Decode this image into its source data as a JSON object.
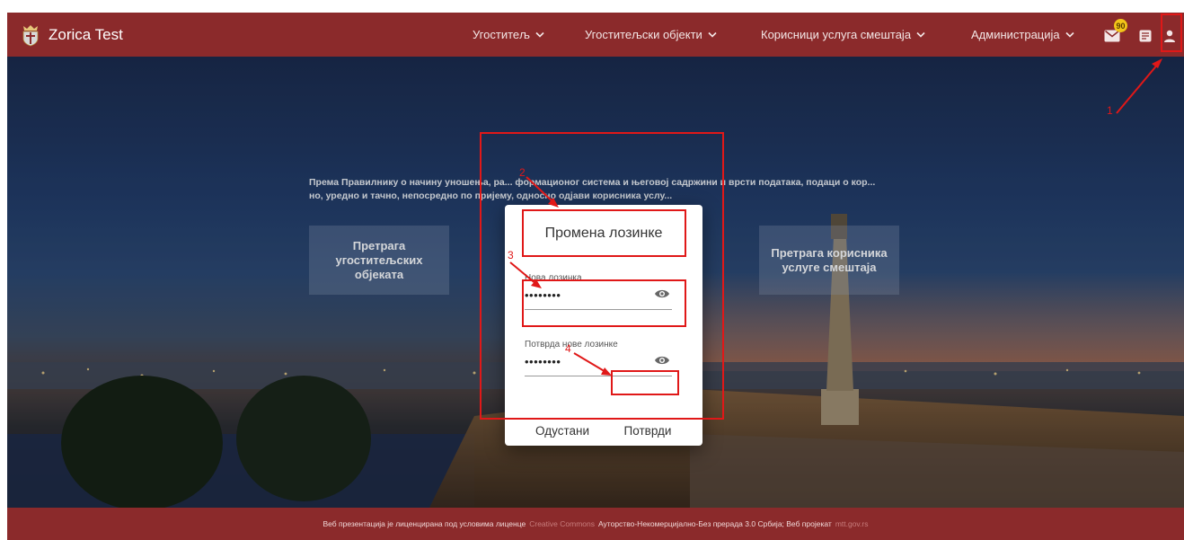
{
  "header": {
    "brand_name": "Zorica Test",
    "nav": [
      {
        "label": "Угоститељ"
      },
      {
        "label": "Угоститељски објекти"
      },
      {
        "label": "Корисници услуга смештаја"
      },
      {
        "label": "Администрација"
      }
    ],
    "notification_count": "90",
    "icons": [
      "crest-icon",
      "mail-icon",
      "messages-icon",
      "user-icon"
    ],
    "color": "#8b2a2b"
  },
  "hero": {
    "intro_text": "Према Правилнику о начину уношења, ра... формационог система и његовој садржини и врсти података, подаци о кор... но, уредно и тачно, непосредно по пријему, односно одјави корисника услу...",
    "tile_left": "Претрага угоститељских објеката",
    "tile_right": "Претрага корисника услуге смештаја"
  },
  "dialog": {
    "title": "Промена лозинке",
    "new_password_label": "Нова лозинка",
    "new_password_value": "••••••••",
    "confirm_password_label": "Потврда нове лозинке",
    "confirm_password_value": "••••••••",
    "cancel_label": "Одустани",
    "confirm_label": "Потврди"
  },
  "annotations": {
    "color": "#e01818",
    "n1": "1",
    "n2": "2",
    "n3": "3",
    "n4": "4"
  },
  "footer": {
    "text_1": "Веб презентација је лиценцирана под условима лиценце",
    "link_cc": "Creative Commons",
    "text_2": "Ауторство-Некомерцијално-Без прерада 3.0 Србија; Веб пројекат",
    "link_site": "mtt.gov.rs"
  }
}
